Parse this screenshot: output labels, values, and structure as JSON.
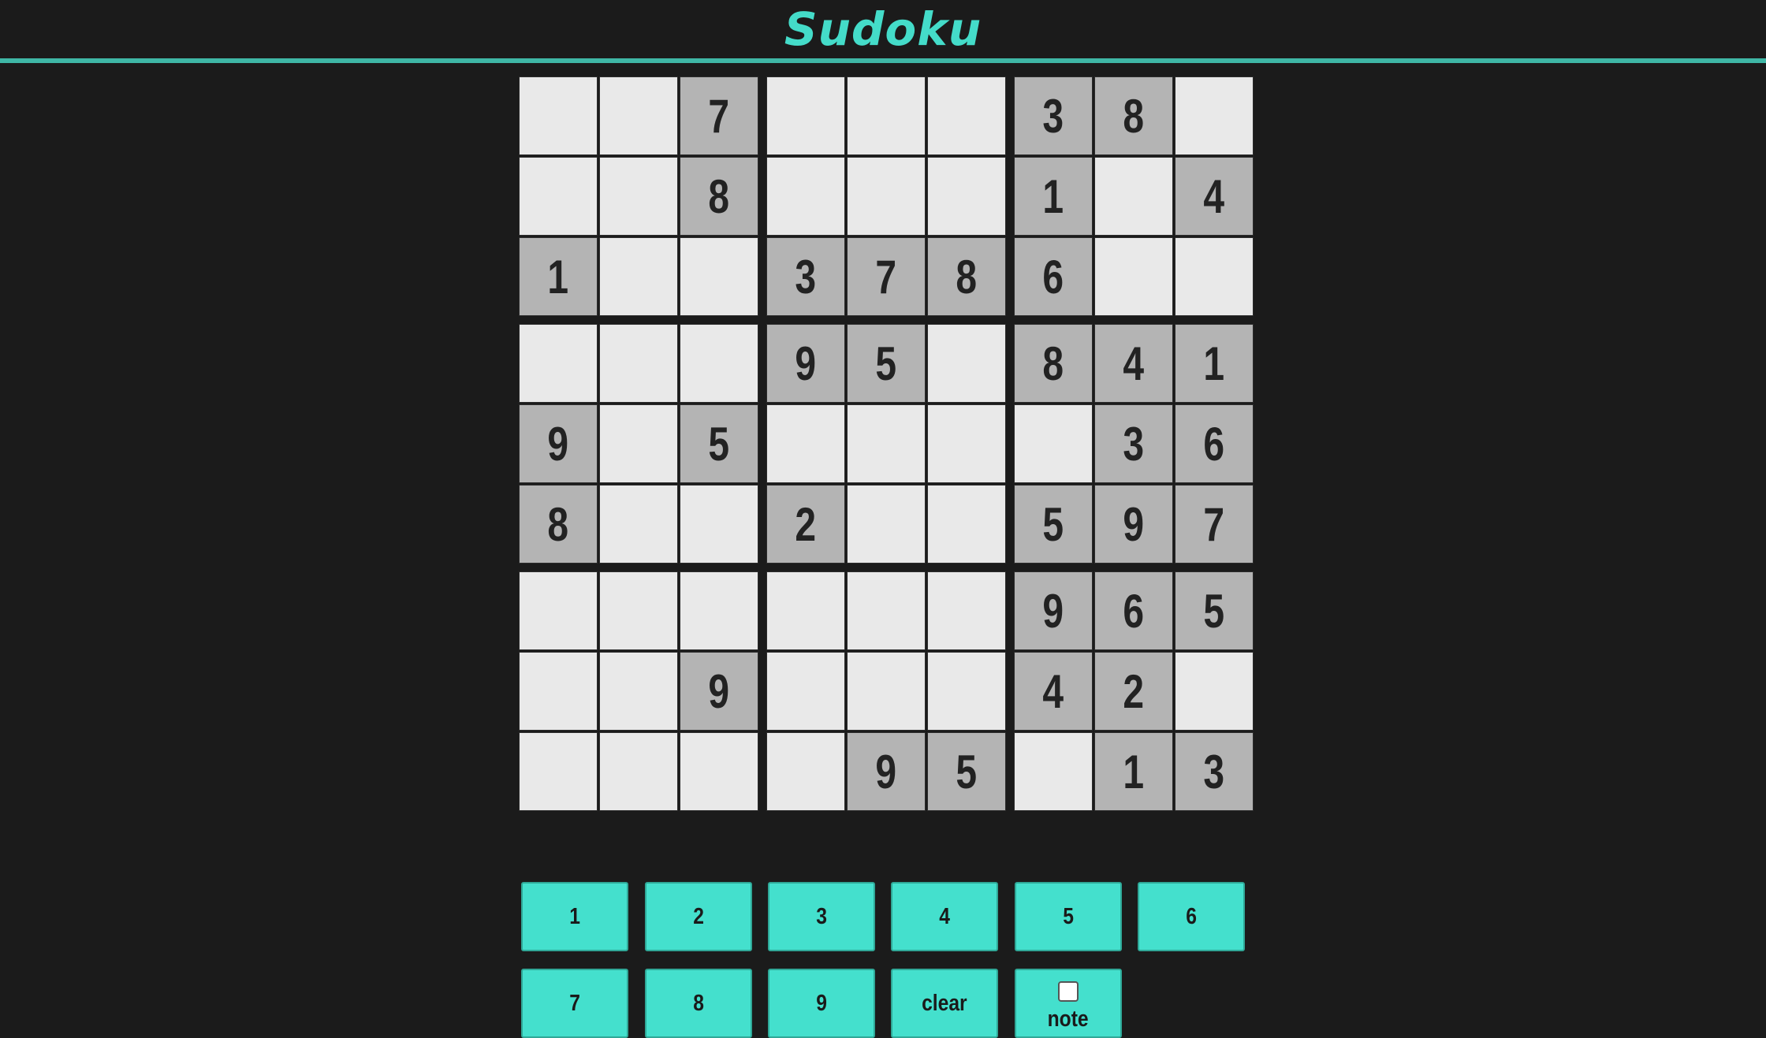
{
  "app": {
    "title": "Sudoku"
  },
  "board": {
    "rows": [
      [
        "",
        "",
        "7",
        "",
        "",
        "",
        "3",
        "8",
        ""
      ],
      [
        "",
        "",
        "8",
        "",
        "",
        "",
        "1",
        "",
        "4"
      ],
      [
        "1",
        "",
        "",
        "3",
        "7",
        "8",
        "6",
        "",
        ""
      ],
      [
        "",
        "",
        "",
        "9",
        "5",
        "",
        "8",
        "4",
        "1"
      ],
      [
        "9",
        "",
        "5",
        "",
        "",
        "",
        "",
        "3",
        "6"
      ],
      [
        "8",
        "",
        "",
        "2",
        "",
        "",
        "5",
        "9",
        "7"
      ],
      [
        "",
        "",
        "",
        "",
        "",
        "",
        "9",
        "6",
        "5"
      ],
      [
        "",
        "",
        "9",
        "",
        "",
        "",
        "4",
        "2",
        ""
      ],
      [
        "",
        "",
        "",
        "",
        "9",
        "5",
        "",
        "1",
        "3"
      ]
    ]
  },
  "controls": {
    "number_buttons": [
      "1",
      "2",
      "3",
      "4",
      "5",
      "6",
      "7",
      "8",
      "9"
    ],
    "clear_label": "clear",
    "note_label": "note",
    "note_checked": false
  },
  "colors": {
    "accent": "#44dcc9",
    "given_cell": "#b4b4b4",
    "empty_cell": "#e9e9e9",
    "background": "#1b1b1b"
  }
}
